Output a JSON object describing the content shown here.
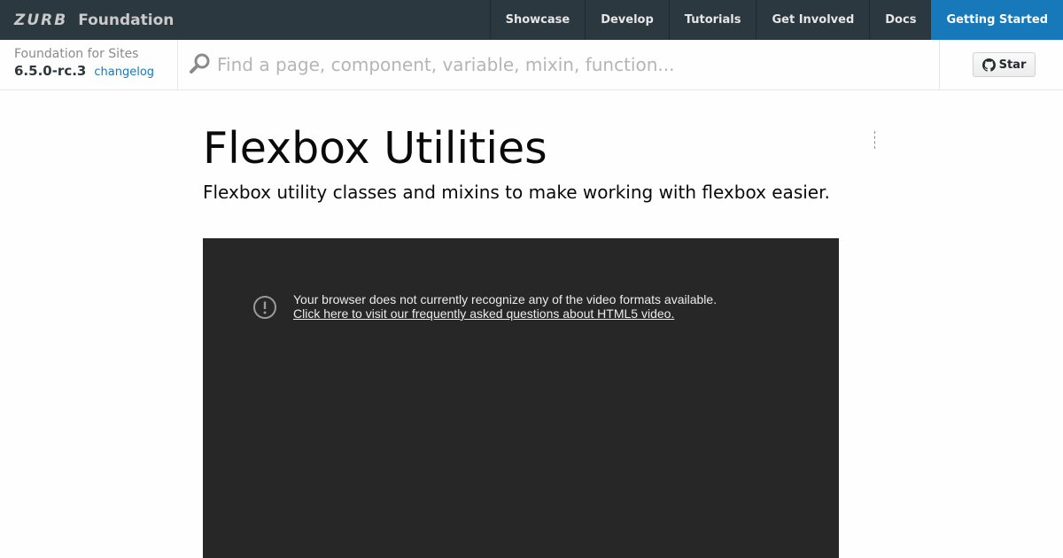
{
  "header": {
    "logo_text": "ZURB",
    "brand": "Foundation",
    "nav": [
      {
        "label": "Showcase"
      },
      {
        "label": "Develop"
      },
      {
        "label": "Tutorials"
      },
      {
        "label": "Get Involved"
      },
      {
        "label": "Docs"
      },
      {
        "label": "Getting Started",
        "active": true
      }
    ]
  },
  "subheader": {
    "product": "Foundation for Sites",
    "version": "6.5.0-rc.3",
    "changelog_label": "changelog",
    "search_placeholder": "Find a page, component, variable, mixin, function...",
    "search_icon": "search-icon",
    "star_label": "Star"
  },
  "main": {
    "title": "Flexbox Utilities",
    "subtitle": "Flexbox utility classes and mixins to make working with flexbox easier.",
    "video": {
      "message": "Your browser does not currently recognize any of the video formats available.",
      "link": "Click here to visit our frequently asked questions about HTML5 video."
    }
  },
  "colors": {
    "topbar": "#2c3840",
    "accent": "#1779ba",
    "video_bg": "#272727"
  }
}
